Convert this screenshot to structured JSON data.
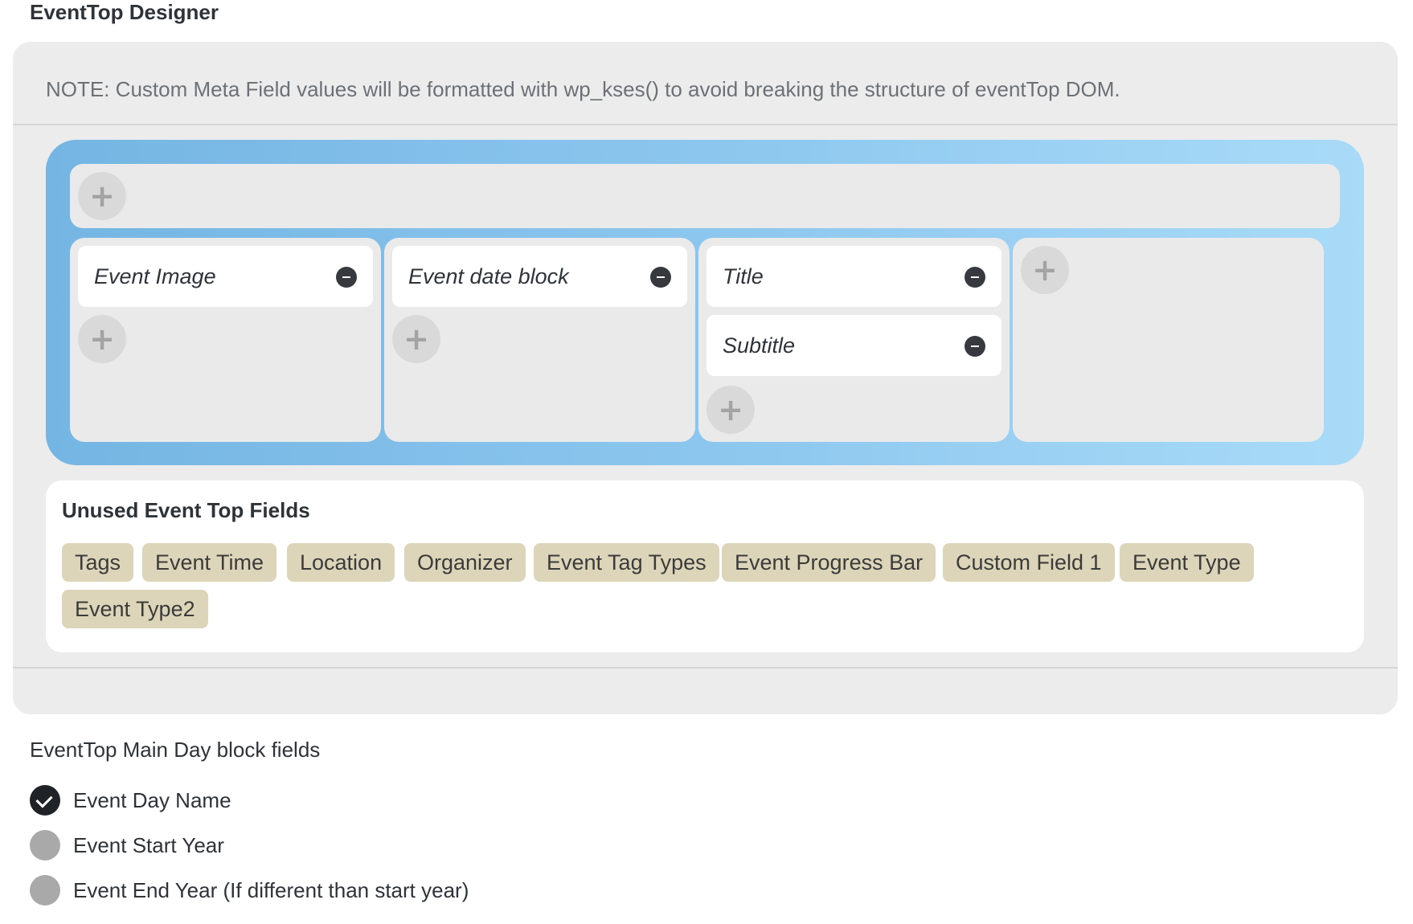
{
  "designer": {
    "title": "EventTop Designer",
    "note": "NOTE: Custom Meta Field values will be formatted with wp_kses() to avoid breaking the structure of eventTop DOM.",
    "add_label": "+",
    "columns": [
      {
        "fields": [
          "Event Image"
        ]
      },
      {
        "fields": [
          "Event date block"
        ]
      },
      {
        "fields": [
          "Title",
          "Subtitle"
        ]
      },
      {
        "fields": []
      }
    ]
  },
  "unused": {
    "title": "Unused Event Top Fields",
    "tags": [
      "Tags",
      "Event Time",
      "Location",
      "Organizer",
      "Event Tag Types",
      "Event Progress Bar",
      "Custom Field 1",
      "Event Type",
      "Event Type2"
    ]
  },
  "main_day": {
    "title": "EventTop Main Day block fields",
    "options": [
      {
        "label": "Event Day Name",
        "checked": true
      },
      {
        "label": "Event Start Year",
        "checked": false
      },
      {
        "label": "Event End Year (If different than start year)",
        "checked": false
      }
    ]
  },
  "colors": {
    "panel_bg": "#ececec",
    "gradient_start": "#74b5e3",
    "gradient_end": "#a9dbf8",
    "tag_bg": "#ddd5b9",
    "toggle_on": "#1f2327",
    "toggle_off": "#a9a9a9"
  }
}
